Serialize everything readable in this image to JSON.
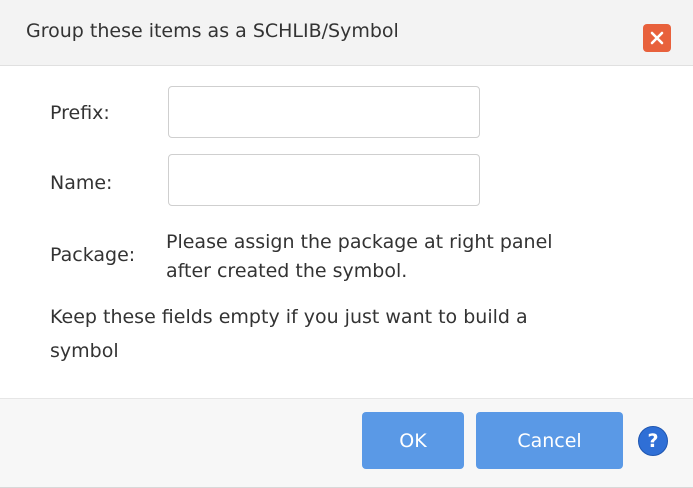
{
  "dialog": {
    "title": "Group these items as a SCHLIB/Symbol",
    "close_icon": "close-icon"
  },
  "form": {
    "prefix_label": "Prefix:",
    "prefix_value": "",
    "name_label": "Name:",
    "name_value": "",
    "package_label": "Package:",
    "package_text_line1": "Please assign the package at right panel",
    "package_text_line2": "after created the symbol.",
    "hint_line1": "Keep these fields empty if you just want to build a",
    "hint_line2": "symbol"
  },
  "footer": {
    "ok_label": "OK",
    "cancel_label": "Cancel",
    "help_icon": "help-icon",
    "help_glyph": "?"
  },
  "colors": {
    "primary_button": "#5a99e6",
    "close_button": "#e8613c",
    "help_icon": "#2f6fd6"
  }
}
